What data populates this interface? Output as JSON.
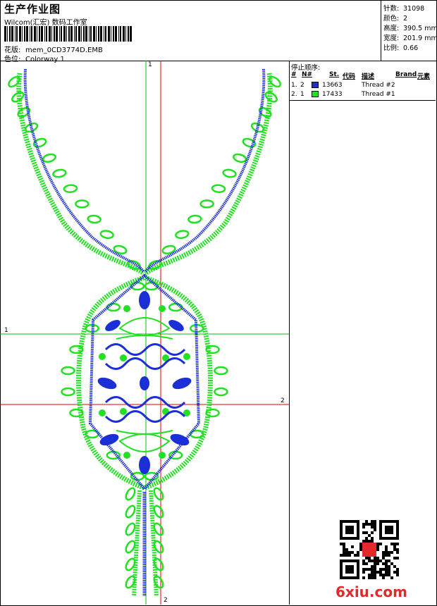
{
  "header": {
    "title": "生产作业图",
    "company": "Wilcom(汇宏) 数码工作室",
    "design_label": "花版:",
    "design_name": "mem_0CD3774D.EMB",
    "colorway_label": "色位:",
    "colorway_name": "Colorway 1"
  },
  "stats": {
    "stitches_label": "针数:",
    "stitches": "31098",
    "colors_label": "颜色:",
    "colors": "2",
    "height_label": "高度:",
    "height": "390.5 mm",
    "width_label": "宽度:",
    "width": "201.9 mm",
    "scale_label": "比例:",
    "scale": "0.66"
  },
  "thread_panel": {
    "title": "停止顺序:",
    "columns": [
      "#",
      "N#",
      "St.",
      "代码",
      "描述",
      "Brand",
      "元素"
    ],
    "rows": [
      {
        "order": "1.",
        "needle": "2",
        "color": "#1b2fd6",
        "stitches": "13663",
        "desc": "Thread #2"
      },
      {
        "order": "2.",
        "needle": "1",
        "color": "#22e022",
        "stitches": "17433",
        "desc": "Thread #1"
      }
    ]
  },
  "axes": {
    "label_1_top": "1",
    "label_1_left": "1",
    "label_2_right": "2",
    "label_2_bottom": "2"
  },
  "colors": {
    "thread_blue": "#1b2fd6",
    "thread_green": "#22e022",
    "guide_green": "#00c000",
    "guide_red": "#e00000"
  },
  "watermark": "6xiu.com"
}
